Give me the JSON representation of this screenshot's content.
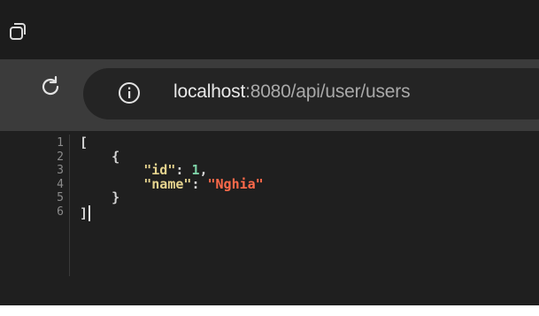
{
  "browser": {
    "address_bar": {
      "host": "localhost",
      "rest": ":8080/api/user/users"
    }
  },
  "editor": {
    "line_numbers": [
      "1",
      "2",
      "3",
      "4",
      "5",
      "6"
    ],
    "lines": {
      "l1": "[",
      "l2": "{",
      "l3_key": "\"id\"",
      "l3_colon": ": ",
      "l3_value": "1",
      "l3_comma": ",",
      "l4_key": "\"name\"",
      "l4_colon": ": ",
      "l4_value": "\"Nghia\"",
      "l5": "}",
      "l6": "]"
    }
  },
  "icons": {
    "tab": "tab-actions-icon",
    "reload": "reload-icon",
    "info": "info-icon"
  }
}
